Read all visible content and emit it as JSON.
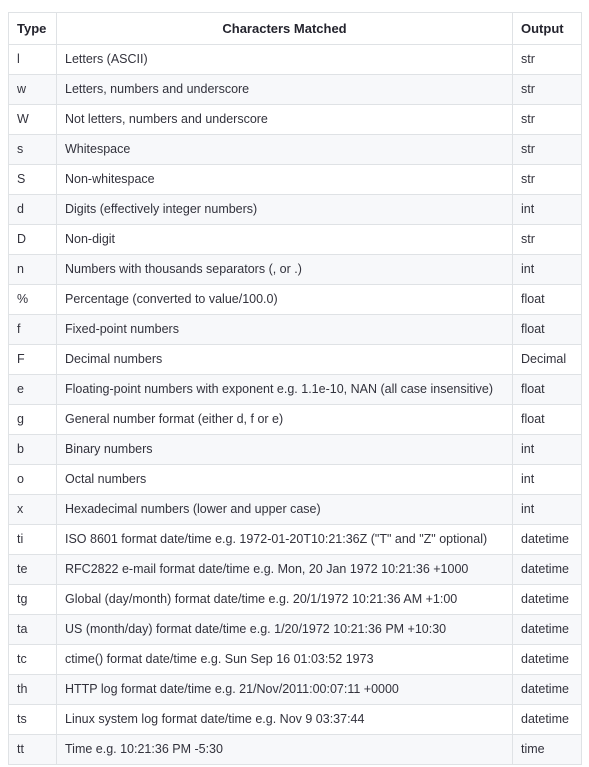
{
  "table": {
    "columns": [
      {
        "key": "type",
        "label": "Type"
      },
      {
        "key": "chars",
        "label": "Characters Matched"
      },
      {
        "key": "output",
        "label": "Output"
      }
    ],
    "rows": [
      {
        "type": "l",
        "chars": "Letters (ASCII)",
        "output": "str"
      },
      {
        "type": "w",
        "chars": "Letters, numbers and underscore",
        "output": "str"
      },
      {
        "type": "W",
        "chars": "Not letters, numbers and underscore",
        "output": "str"
      },
      {
        "type": "s",
        "chars": "Whitespace",
        "output": "str"
      },
      {
        "type": "S",
        "chars": "Non-whitespace",
        "output": "str"
      },
      {
        "type": "d",
        "chars": "Digits (effectively integer numbers)",
        "output": "int"
      },
      {
        "type": "D",
        "chars": "Non-digit",
        "output": "str"
      },
      {
        "type": "n",
        "chars": "Numbers with thousands separators (, or .)",
        "output": "int"
      },
      {
        "type": "%",
        "chars": "Percentage (converted to value/100.0)",
        "output": "float"
      },
      {
        "type": "f",
        "chars": "Fixed-point numbers",
        "output": "float"
      },
      {
        "type": "F",
        "chars": "Decimal numbers",
        "output": "Decimal"
      },
      {
        "type": "e",
        "chars": "Floating-point numbers with exponent e.g. 1.1e-10, NAN (all case insensitive)",
        "output": "float"
      },
      {
        "type": "g",
        "chars": "General number format (either d, f or e)",
        "output": "float"
      },
      {
        "type": "b",
        "chars": "Binary numbers",
        "output": "int"
      },
      {
        "type": "o",
        "chars": "Octal numbers",
        "output": "int"
      },
      {
        "type": "x",
        "chars": "Hexadecimal numbers (lower and upper case)",
        "output": "int"
      },
      {
        "type": "ti",
        "chars": "ISO 8601 format date/time e.g. 1972-01-20T10:21:36Z (\"T\" and \"Z\" optional)",
        "output": "datetime"
      },
      {
        "type": "te",
        "chars": "RFC2822 e-mail format date/time e.g. Mon, 20 Jan 1972 10:21:36 +1000",
        "output": "datetime"
      },
      {
        "type": "tg",
        "chars": "Global (day/month) format date/time e.g. 20/1/1972 10:21:36 AM +1:00",
        "output": "datetime"
      },
      {
        "type": "ta",
        "chars": "US (month/day) format date/time e.g. 1/20/1972 10:21:36 PM +10:30",
        "output": "datetime"
      },
      {
        "type": "tc",
        "chars": "ctime() format date/time e.g. Sun Sep 16 01:03:52 1973",
        "output": "datetime"
      },
      {
        "type": "th",
        "chars": "HTTP log format date/time e.g. 21/Nov/2011:00:07:11 +0000",
        "output": "datetime"
      },
      {
        "type": "ts",
        "chars": "Linux system log format date/time e.g. Nov 9 03:37:44",
        "output": "datetime"
      },
      {
        "type": "tt",
        "chars": "Time e.g. 10:21:36 PM -5:30",
        "output": "time"
      }
    ]
  },
  "colors": {
    "border": "#dfe2e5",
    "stripe": "#f7f8fa",
    "text": "#32323c",
    "header_text": "#24242e",
    "background": "#ffffff"
  }
}
